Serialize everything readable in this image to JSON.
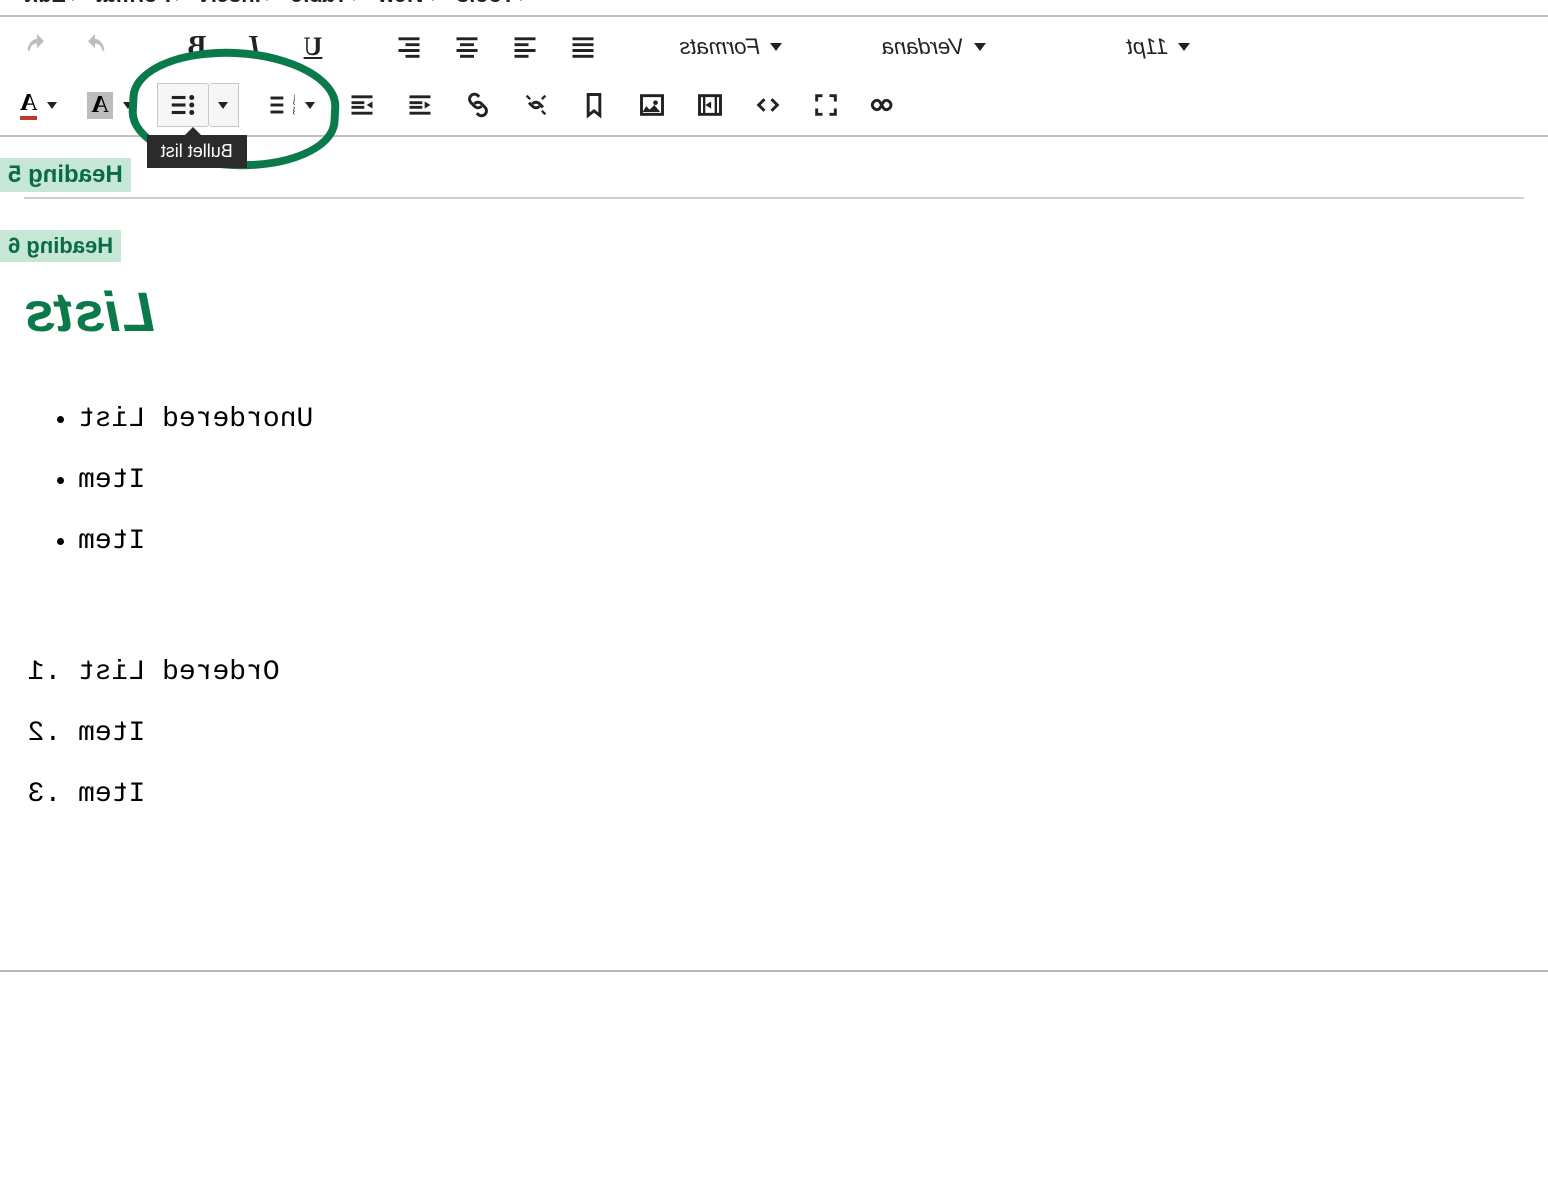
{
  "menubar": {
    "edit": "Edit",
    "format": "Format",
    "insert": "Insert",
    "table": "Table",
    "view": "View",
    "tools": "Tools"
  },
  "toolbar": {
    "formats_label": "Formats",
    "font_family": "Verdana",
    "font_size": "11pt",
    "bold_glyph": "B",
    "italic_glyph": "I",
    "underline_glyph": "U",
    "text_color_glyph": "A",
    "bg_color_glyph": "A"
  },
  "tooltip": {
    "bullet_list": "Bullet list"
  },
  "preview": {
    "heading5": "Heading 5",
    "heading6": "Heading 6"
  },
  "content": {
    "title": "Lists",
    "ul": [
      "Unordered List",
      "Item",
      "Item"
    ],
    "ol": [
      "Ordered List",
      "Item",
      "Item"
    ]
  },
  "colors": {
    "accent": "#0a7a4b"
  }
}
